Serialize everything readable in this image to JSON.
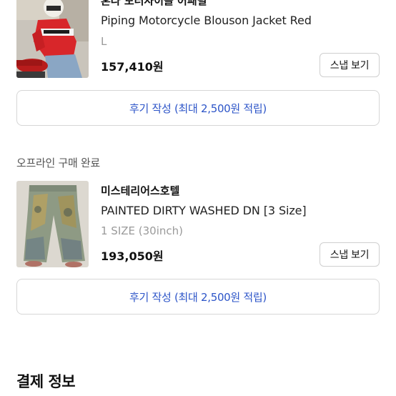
{
  "item1": {
    "brand": "혼다 모터사이클 어패럴",
    "product_name": "Piping Motorcycle Blouson Jacket Red",
    "option": "L",
    "price": "157,410원",
    "snap_label": "스냅 보기",
    "review_label": "후기 작성 (최대 2,500원 적립)"
  },
  "item2": {
    "status": "오프라인 구매 완료",
    "brand": "미스테리어스호텔",
    "product_name": "PAINTED DIRTY WASHED DN [3 Size]",
    "option": "1 SIZE (30inch)",
    "price": "193,050원",
    "snap_label": "스냅 보기",
    "review_label": "후기 작성 (최대 2,500원 적립)"
  },
  "payment": {
    "title": "결제 정보"
  },
  "colors": {
    "accent": "#2d55c8",
    "muted": "#9a9a9a",
    "border": "#d6d6d6"
  }
}
